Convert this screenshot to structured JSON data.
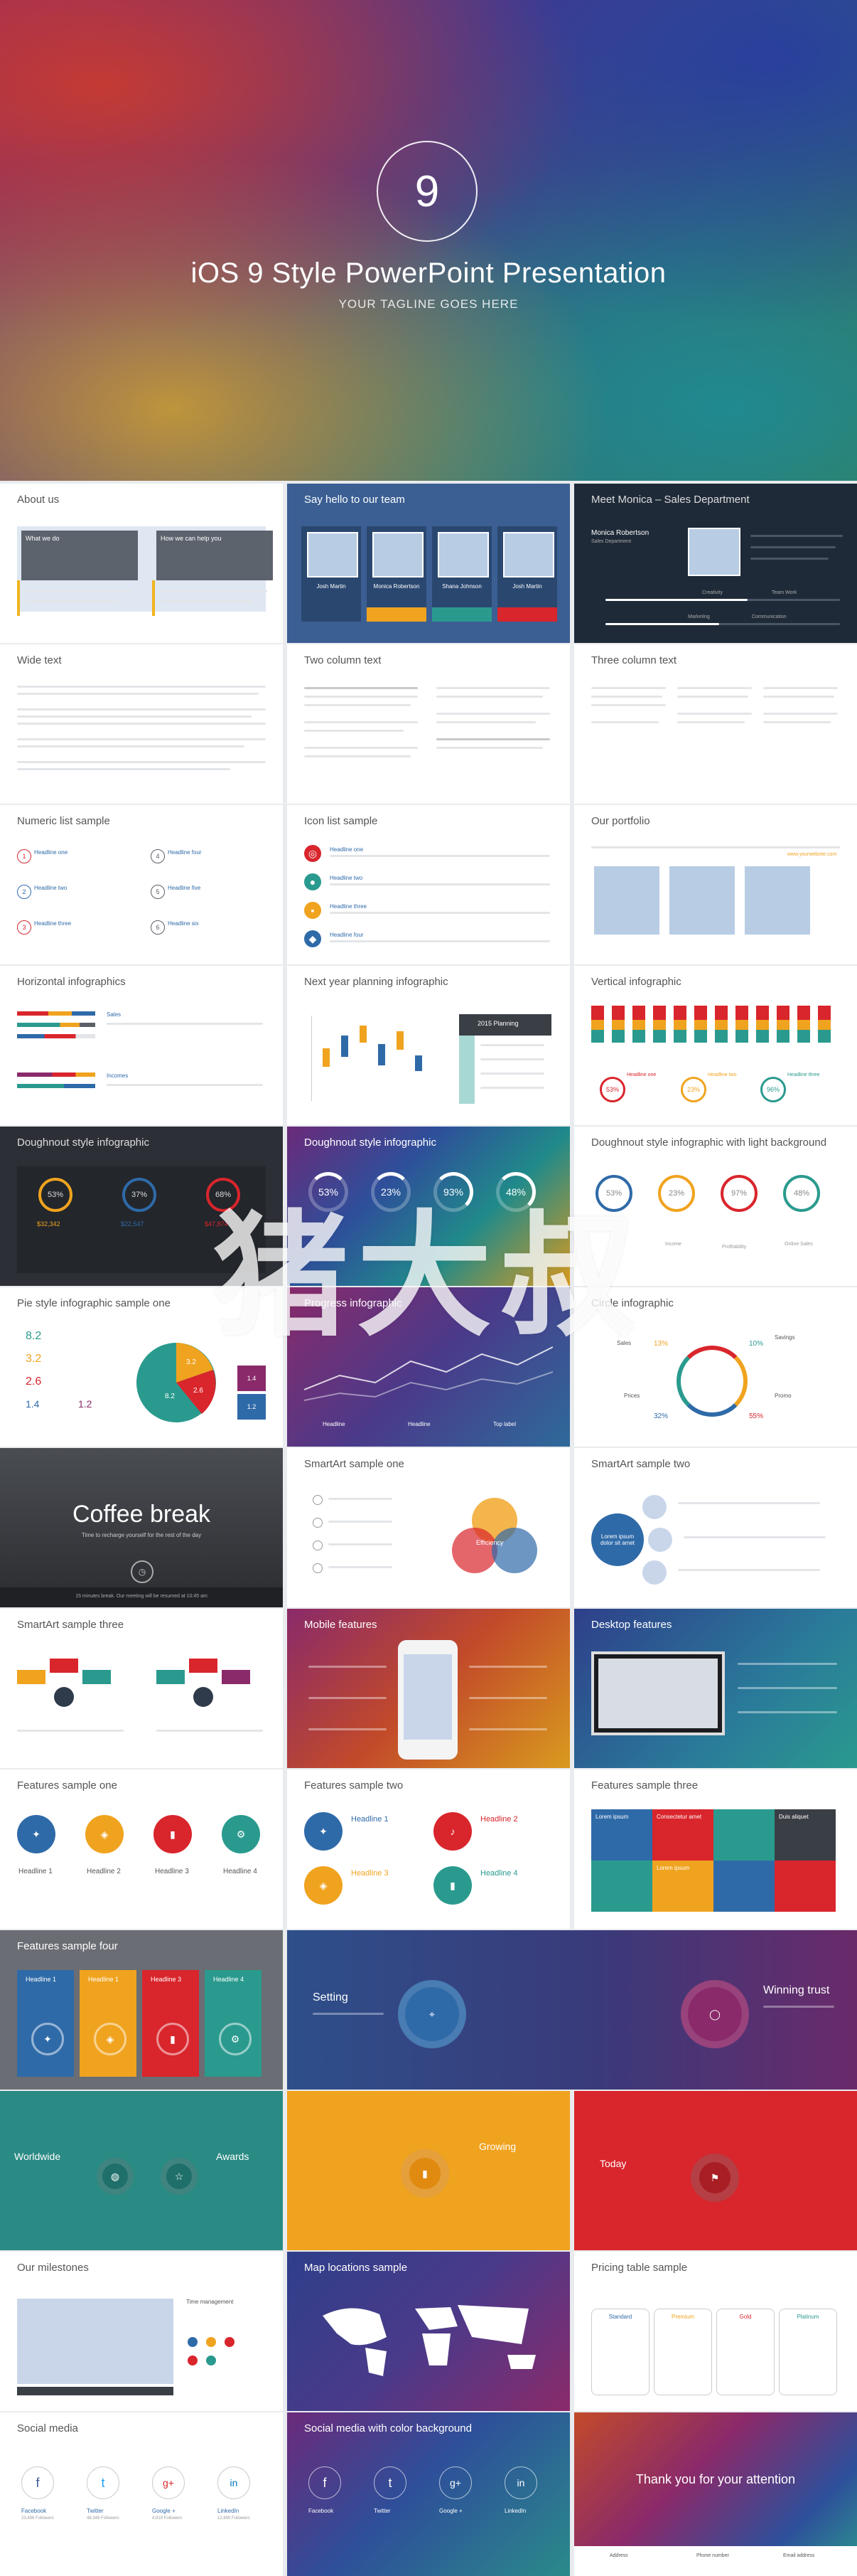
{
  "hero": {
    "number": "9",
    "title": "iOS 9 Style PowerPoint Presentation",
    "tagline": "YOUR TAGLINE GOES HERE"
  },
  "slides": {
    "about": {
      "title": "About us",
      "col1": "What we do",
      "col2": "How we can help you"
    },
    "team": {
      "title": "Say hello to our team",
      "members": [
        "Josh Martin",
        "Monica Robertson",
        "Shana Johnson",
        "Josh Martin"
      ]
    },
    "meet": {
      "title": "Meet Monica – Sales Department",
      "name": "Monica Robertson",
      "role": "Sales Department",
      "bars": [
        "Creativity",
        "Team Work",
        "Marketing",
        "Communication"
      ]
    },
    "wide": {
      "title": "Wide text"
    },
    "twocol": {
      "title": "Two column text"
    },
    "threecol": {
      "title": "Three column text"
    },
    "numlist": {
      "title": "Numeric list sample",
      "items": [
        "Headline one",
        "Headline two",
        "Headline three",
        "Headline four",
        "Headline five",
        "Headline six"
      ],
      "nums": [
        "1",
        "2",
        "3",
        "4",
        "5",
        "6"
      ]
    },
    "iconlist": {
      "title": "Icon list sample",
      "items": [
        "Headline one",
        "Headline two",
        "Headline three",
        "Headline four"
      ]
    },
    "portfolio": {
      "title": "Our portfolio",
      "link": "www.yourwebsite.com"
    },
    "horiz": {
      "title": "Horizontal infographics",
      "labels": [
        "Sales",
        "Incomes"
      ]
    },
    "nextyear": {
      "title": "Next year planning infographic",
      "panel": "2015 Planning"
    },
    "vertical": {
      "title": "Vertical infographic",
      "pcts": [
        "53%",
        "23%",
        "96%"
      ],
      "labels": [
        "Headline one",
        "Headline two",
        "Headline three"
      ]
    },
    "donut1": {
      "title": "Doughnout style infographic",
      "pcts": [
        "53%",
        "37%",
        "68%"
      ],
      "values": [
        "$32,342",
        "$22,547",
        "$47,874"
      ]
    },
    "donut2": {
      "title": "Doughnout style infographic",
      "pcts": [
        "53%",
        "23%",
        "93%",
        "48%"
      ]
    },
    "donut3": {
      "title": "Doughnout style infographic with light background",
      "pcts": [
        "53%",
        "23%",
        "97%",
        "48%"
      ],
      "labels": [
        "Income",
        "Profitability",
        "Online Sales"
      ]
    },
    "pie": {
      "title": "Pie style infographic sample one",
      "nums": [
        "8.2",
        "3.2",
        "2.6",
        "1.4",
        "1.2"
      ],
      "slices": [
        "8.2",
        "3.2",
        "2.6",
        "1.4",
        "1.2"
      ]
    },
    "progress": {
      "title": "Progress infographic",
      "labels": [
        "Headline",
        "Headline",
        "Top label"
      ]
    },
    "circle": {
      "title": "Circle infographic",
      "labels": [
        "Sales",
        "Savings",
        "Prices",
        "Promo"
      ],
      "pcts": [
        "13%",
        "10%",
        "32%",
        "55%"
      ]
    },
    "coffee": {
      "title": "Coffee break",
      "sub": "Time to recharge yourself for the rest of the day",
      "note": "15 minutes break. Our meeting will be resumed at 10:45 am"
    },
    "smartart1": {
      "title": "SmartArt sample one",
      "center": "Efficiency"
    },
    "smartart2": {
      "title": "SmartArt sample two",
      "center": "Lorem ipsum dolor sit amet"
    },
    "smartart3": {
      "title": "SmartArt sample three"
    },
    "mobile": {
      "title": "Mobile features"
    },
    "desktop": {
      "title": "Desktop features"
    },
    "feat1": {
      "title": "Features sample one",
      "items": [
        "Headline 1",
        "Headline 2",
        "Headline 3",
        "Headline 4"
      ]
    },
    "feat2": {
      "title": "Features sample two",
      "items": [
        "Headline 1",
        "Headline 2",
        "Headline 3",
        "Headline 4"
      ]
    },
    "feat3": {
      "title": "Features sample three",
      "cells": [
        "Lorem ipsum",
        "Consectetur amet",
        "Duis aliquet",
        "Lorem ipsum"
      ]
    },
    "feat4": {
      "title": "Features sample four",
      "items": [
        "Headline 1",
        "Headline 1",
        "Headline 3",
        "Headline 4"
      ]
    },
    "setting": {
      "title": "Setting"
    },
    "winning": {
      "title": "Winning trust"
    },
    "worldwide": {
      "title": "Worldwide",
      "awards": "Awards"
    },
    "growing": {
      "title": "Growing"
    },
    "today": {
      "title": "Today"
    },
    "milestones": {
      "title": "Our milestones",
      "side": "Time management"
    },
    "maps": {
      "title": "Map locations sample"
    },
    "pricing": {
      "title": "Pricing table sample",
      "plans": [
        "Standard",
        "Premium",
        "Gold",
        "Platinum"
      ]
    },
    "social": {
      "title": "Social media",
      "nets": [
        "Facebook",
        "Twitter",
        "Google +",
        "LinkedIn"
      ],
      "fans": [
        "23,496 Followers",
        "48,349 Followers",
        "4,919 Followers",
        "12,690 Followers"
      ]
    },
    "socialbg": {
      "title": "Social media with color background",
      "nets": [
        "Facebook",
        "Twitter",
        "Google +",
        "LinkedIn"
      ]
    },
    "thanks": {
      "title": "Thank you for your attention",
      "labels": [
        "Address",
        "Phone number",
        "Email address"
      ]
    }
  },
  "watermark": "猪大叔",
  "colors": {
    "blue": "#2f6aa8",
    "orange": "#f0a31f",
    "red": "#d9252c",
    "teal": "#2a9a8e",
    "gray": "#5b5f66"
  }
}
